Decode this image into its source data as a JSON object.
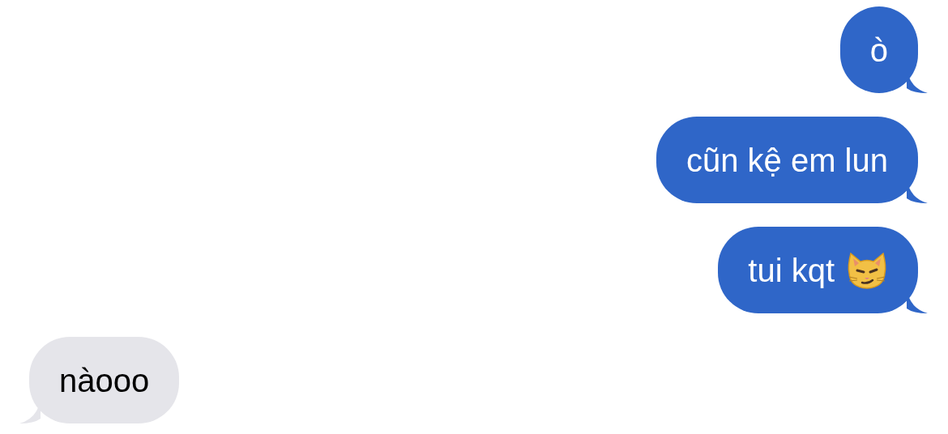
{
  "messages": [
    {
      "text": "ò",
      "outgoing": true,
      "kind": "text"
    },
    {
      "text": "cũn kệ em lun",
      "outgoing": true,
      "kind": "text"
    },
    {
      "text": "tui kqt",
      "outgoing": true,
      "kind": "emoji"
    },
    {
      "text": "nàooo",
      "outgoing": false,
      "kind": "text"
    }
  ]
}
